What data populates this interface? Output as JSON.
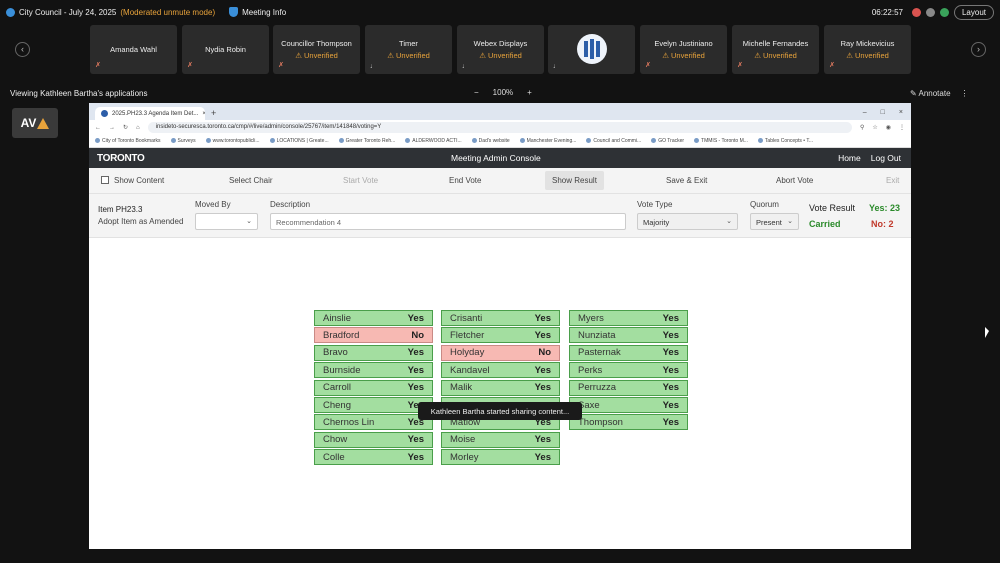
{
  "topbar": {
    "title": "City Council - July 24, 2025",
    "mode": "(Moderated unmute mode)",
    "meeting_info": "Meeting Info",
    "clock": "06:22:57",
    "layout": "Layout"
  },
  "participants": [
    {
      "name": "Amanda Wahl",
      "status": ""
    },
    {
      "name": "Nydia Robin",
      "status": ""
    },
    {
      "name": "Councillor Thompson",
      "status": "Unverified"
    },
    {
      "name": "Timer",
      "status": "Unverified"
    },
    {
      "name": "Webex Displays",
      "status": "Unverified"
    },
    {
      "name": "",
      "status": ""
    },
    {
      "name": "Evelyn Justiniano",
      "status": "Unverified"
    },
    {
      "name": "Michelle Fernandes",
      "status": "Unverified"
    },
    {
      "name": "Ray Mickevicius",
      "status": "Unverified"
    }
  ],
  "share": {
    "viewing": "Viewing Kathleen Bartha's applications",
    "zoom": "100%",
    "annotate": "Annotate"
  },
  "av_logo": "AV",
  "browser": {
    "tab_title": "2025.PH23.3 Agenda Item Det...",
    "url": "insideto-securesca.toronto.ca/cmp/#/live/admin/console/25767/item/141848/voting=Y",
    "bookmarks": [
      "City of Toronto Bookmarks",
      "Surveys",
      "www.torontopublicli...",
      "LOCATIONS | Greate...",
      "Greater Toronto Reh...",
      "ALDERWOOD ACTI...",
      "Dad's website",
      "Manchester Evening...",
      "Council and Commi...",
      "GO Tracker",
      "TMMIS - Toronto M...",
      "Tables Concepts • T..."
    ]
  },
  "app": {
    "brand": "TORONTO",
    "title": "Meeting Admin Console",
    "home": "Home",
    "logout": "Log Out"
  },
  "toolbar": {
    "show_content": "Show Content",
    "select_chair": "Select Chair",
    "start_vote": "Start Vote",
    "end_vote": "End Vote",
    "show_result": "Show Result",
    "save_exit": "Save & Exit",
    "abort_vote": "Abort Vote",
    "exit": "Exit"
  },
  "item": {
    "number": "Item PH23.3",
    "action": "Adopt Item as Amended",
    "moved_by_label": "Moved By",
    "moved_by_value": "",
    "description_label": "Description",
    "description_value": "Recommendation 4",
    "vote_type_label": "Vote Type",
    "vote_type_value": "Majority",
    "quorum_label": "Quorum",
    "quorum_value": "Present",
    "vote_result_label": "Vote Result",
    "result": "Carried",
    "yes": "Yes: 23",
    "no": "No: 2"
  },
  "votes": [
    [
      {
        "name": "Ainslie",
        "vote": "Yes"
      },
      {
        "name": "Bradford",
        "vote": "No"
      },
      {
        "name": "Bravo",
        "vote": "Yes"
      },
      {
        "name": "Burnside",
        "vote": "Yes"
      },
      {
        "name": "Carroll",
        "vote": "Yes"
      },
      {
        "name": "Cheng",
        "vote": "Yes"
      },
      {
        "name": "Chernos Lin",
        "vote": "Yes"
      },
      {
        "name": "Chow",
        "vote": "Yes"
      },
      {
        "name": "Colle",
        "vote": "Yes"
      }
    ],
    [
      {
        "name": "Crisanti",
        "vote": "Yes"
      },
      {
        "name": "Fletcher",
        "vote": "Yes"
      },
      {
        "name": "Holyday",
        "vote": "No"
      },
      {
        "name": "Kandavel",
        "vote": "Yes"
      },
      {
        "name": "Malik",
        "vote": "Yes"
      },
      {
        "name": "",
        "vote": ""
      },
      {
        "name": "Matlow",
        "vote": "Yes"
      },
      {
        "name": "Moise",
        "vote": "Yes"
      },
      {
        "name": "Morley",
        "vote": "Yes"
      }
    ],
    [
      {
        "name": "Myers",
        "vote": "Yes"
      },
      {
        "name": "Nunziata",
        "vote": "Yes"
      },
      {
        "name": "Pasternak",
        "vote": "Yes"
      },
      {
        "name": "Perks",
        "vote": "Yes"
      },
      {
        "name": "Perruzza",
        "vote": "Yes"
      },
      {
        "name": "Saxe",
        "vote": "Yes"
      },
      {
        "name": "Thompson",
        "vote": "Yes"
      }
    ]
  ],
  "toast": "Kathleen Bartha started sharing content..."
}
